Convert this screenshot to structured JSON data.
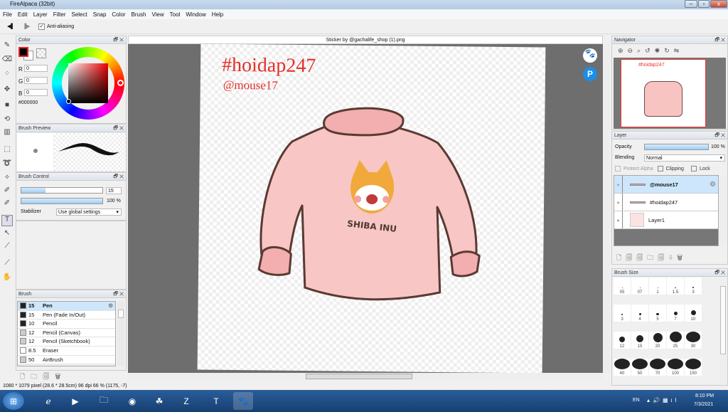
{
  "window": {
    "title": "FireAlpaca (32bit)",
    "min": "–",
    "max": "▫",
    "close": "x"
  },
  "menu": [
    "File",
    "Edit",
    "Layer",
    "Filter",
    "Select",
    "Snap",
    "Color",
    "Brush",
    "View",
    "Tool",
    "Window",
    "Help"
  ],
  "toolbar": {
    "prev": "◀▌",
    "next": "▐▶",
    "anti_alias_label": "Anti-aliasing",
    "anti_alias_checked": true
  },
  "color_panel": {
    "title": "Color",
    "r_label": "R",
    "r": "0",
    "g_label": "G",
    "g": "0",
    "b_label": "B",
    "b": "0",
    "hex": "#000000",
    "fg": "#000000"
  },
  "brush_preview": {
    "title": "Brush Preview"
  },
  "brush_control": {
    "title": "Brush Control",
    "size": "15",
    "size_fraction": 0.3,
    "opacity": "100 %",
    "opacity_fraction": 1.0,
    "stabilizer_label": "Stabilizer",
    "stabilizer_value": "Use global settings"
  },
  "brush_panel": {
    "title": "Brush",
    "items": [
      {
        "size": "15",
        "name": "Pen",
        "swatch": "#222222",
        "selected": true
      },
      {
        "size": "15",
        "name": "Pen (Fade In/Out)",
        "swatch": "#222222"
      },
      {
        "size": "10",
        "name": "Pencil",
        "swatch": "#222222"
      },
      {
        "size": "12",
        "name": "Pencil (Canvas)",
        "swatch": "#cccccc"
      },
      {
        "size": "12",
        "name": "Pencil (Sketchbook)",
        "swatch": "#cccccc"
      },
      {
        "size": "8.5",
        "name": "Eraser",
        "swatch": "#ffffff"
      },
      {
        "size": "50",
        "name": "AirBrush",
        "swatch": "#cccccc"
      }
    ]
  },
  "canvas": {
    "tab": "Sticker by @gachalife_shop (1).png",
    "text1": "#hoidap247",
    "text2": "@mouse17",
    "logo_text": "SHIBA INU"
  },
  "status": "1080 * 1079 pixel   (28.6 * 28.5cm)   96 dpi   66 %   (1175, -7)",
  "navigator": {
    "title": "Navigator"
  },
  "layer_panel": {
    "title": "Layer",
    "opacity_label": "Opacity",
    "opacity": "100 %",
    "opacity_fraction": 1.0,
    "blending_label": "Blending",
    "blending": "Normal",
    "protect_alpha": "Protect Alpha",
    "clipping": "Clipping",
    "lock": "Lock",
    "layers": [
      {
        "name": "@mouse17",
        "selected": true
      },
      {
        "name": "#hoidap247"
      },
      {
        "name": "Layer1"
      }
    ]
  },
  "brush_size": {
    "title": "Brush Size",
    "sizes": [
      {
        "label": "05"
      },
      {
        "label": "07"
      },
      {
        "label": "1"
      },
      {
        "label": "1.5"
      },
      {
        "label": "3"
      },
      {
        "label": "3"
      },
      {
        "label": "4"
      },
      {
        "label": "5"
      },
      {
        "label": "7"
      },
      {
        "label": "10"
      },
      {
        "label": "12"
      },
      {
        "label": "15"
      },
      {
        "label": "20"
      },
      {
        "label": "25"
      },
      {
        "label": "30"
      },
      {
        "label": "40"
      },
      {
        "label": "50"
      },
      {
        "label": "70"
      },
      {
        "label": "100"
      },
      {
        "label": "150"
      }
    ]
  },
  "tray": {
    "lang": "EN",
    "time": "8:10 PM",
    "date": "7/3/2021"
  }
}
